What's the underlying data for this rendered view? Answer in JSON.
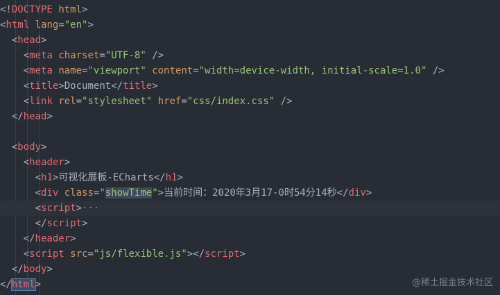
{
  "editor": {
    "theme": {
      "background": "#282c34",
      "tag": "#e06c75",
      "attr": "#d19a66",
      "string": "#98c379",
      "text": "#abb2bf"
    },
    "lines": [
      {
        "tokens": [
          {
            "t": "punct",
            "v": "<!"
          },
          {
            "t": "tag",
            "v": "DOCTYPE"
          },
          {
            "t": "punct",
            "v": " "
          },
          {
            "t": "attr",
            "v": "html"
          },
          {
            "t": "punct",
            "v": ">"
          }
        ]
      },
      {
        "tokens": [
          {
            "t": "punct",
            "v": "<"
          },
          {
            "t": "tag",
            "v": "html"
          },
          {
            "t": "punct",
            "v": " "
          },
          {
            "t": "attr",
            "v": "lang"
          },
          {
            "t": "punct",
            "v": "="
          },
          {
            "t": "str",
            "v": "\"en\""
          },
          {
            "t": "punct",
            "v": ">"
          }
        ]
      },
      {
        "tokens": [
          {
            "t": "punct",
            "v": "  <"
          },
          {
            "t": "tag",
            "v": "head"
          },
          {
            "t": "punct",
            "v": ">"
          }
        ]
      },
      {
        "tokens": [
          {
            "t": "punct",
            "v": "    <"
          },
          {
            "t": "tag",
            "v": "meta"
          },
          {
            "t": "punct",
            "v": " "
          },
          {
            "t": "attr",
            "v": "charset"
          },
          {
            "t": "punct",
            "v": "="
          },
          {
            "t": "str",
            "v": "\"UTF-8\""
          },
          {
            "t": "punct",
            "v": " />"
          }
        ]
      },
      {
        "tokens": [
          {
            "t": "punct",
            "v": "    <"
          },
          {
            "t": "tag",
            "v": "meta"
          },
          {
            "t": "punct",
            "v": " "
          },
          {
            "t": "attr",
            "v": "name"
          },
          {
            "t": "punct",
            "v": "="
          },
          {
            "t": "str",
            "v": "\"viewport\""
          },
          {
            "t": "punct",
            "v": " "
          },
          {
            "t": "attr",
            "v": "content"
          },
          {
            "t": "punct",
            "v": "="
          },
          {
            "t": "str",
            "v": "\"width=device-width, initial-scale=1.0\""
          },
          {
            "t": "punct",
            "v": " />"
          }
        ]
      },
      {
        "tokens": [
          {
            "t": "punct",
            "v": "    <"
          },
          {
            "t": "tag",
            "v": "title"
          },
          {
            "t": "punct",
            "v": ">"
          },
          {
            "t": "text",
            "v": "Document"
          },
          {
            "t": "punct",
            "v": "</"
          },
          {
            "t": "tag",
            "v": "title"
          },
          {
            "t": "punct",
            "v": ">"
          }
        ]
      },
      {
        "tokens": [
          {
            "t": "punct",
            "v": "    <"
          },
          {
            "t": "tag",
            "v": "link"
          },
          {
            "t": "punct",
            "v": " "
          },
          {
            "t": "attr",
            "v": "rel"
          },
          {
            "t": "punct",
            "v": "="
          },
          {
            "t": "str",
            "v": "\"stylesheet\""
          },
          {
            "t": "punct",
            "v": " "
          },
          {
            "t": "attr",
            "v": "href"
          },
          {
            "t": "punct",
            "v": "="
          },
          {
            "t": "str",
            "v": "\"css/index.css\""
          },
          {
            "t": "punct",
            "v": " />"
          }
        ]
      },
      {
        "tokens": [
          {
            "t": "punct",
            "v": "  </"
          },
          {
            "t": "tag",
            "v": "head"
          },
          {
            "t": "punct",
            "v": ">"
          }
        ]
      },
      {
        "tokens": []
      },
      {
        "tokens": [
          {
            "t": "punct",
            "v": "  <"
          },
          {
            "t": "tag",
            "v": "body"
          },
          {
            "t": "punct",
            "v": ">"
          }
        ]
      },
      {
        "tokens": [
          {
            "t": "punct",
            "v": "    <"
          },
          {
            "t": "tag",
            "v": "header"
          },
          {
            "t": "punct",
            "v": ">"
          }
        ]
      },
      {
        "tokens": [
          {
            "t": "punct",
            "v": "      <"
          },
          {
            "t": "tag",
            "v": "h1"
          },
          {
            "t": "punct",
            "v": ">"
          },
          {
            "t": "text",
            "v": "可视化展板-ECharts"
          },
          {
            "t": "punct",
            "v": "</"
          },
          {
            "t": "tag",
            "v": "h1"
          },
          {
            "t": "punct",
            "v": ">"
          }
        ]
      },
      {
        "tokens": [
          {
            "t": "punct",
            "v": "      <"
          },
          {
            "t": "tag",
            "v": "div"
          },
          {
            "t": "punct",
            "v": " "
          },
          {
            "t": "attr",
            "v": "class"
          },
          {
            "t": "punct",
            "v": "="
          },
          {
            "t": "str",
            "v": "\""
          },
          {
            "t": "str-hl",
            "v": "showTime"
          },
          {
            "t": "str",
            "v": "\""
          },
          {
            "t": "punct",
            "v": ">"
          },
          {
            "t": "text",
            "v": "当前时间：2020年3月17-0时54分14秒"
          },
          {
            "t": "punct",
            "v": "</"
          },
          {
            "t": "tag",
            "v": "div"
          },
          {
            "t": "punct",
            "v": ">"
          }
        ]
      },
      {
        "tokens": [
          {
            "t": "punct",
            "v": "      <"
          },
          {
            "t": "tag",
            "v": "script"
          },
          {
            "t": "punct",
            "v": ">"
          },
          {
            "t": "fold",
            "v": "···"
          }
        ]
      },
      {
        "tokens": [
          {
            "t": "punct",
            "v": "      </"
          },
          {
            "t": "tag",
            "v": "script"
          },
          {
            "t": "punct",
            "v": ">"
          }
        ]
      },
      {
        "tokens": [
          {
            "t": "punct",
            "v": "    </"
          },
          {
            "t": "tag",
            "v": "header"
          },
          {
            "t": "punct",
            "v": ">"
          }
        ]
      },
      {
        "tokens": [
          {
            "t": "punct",
            "v": "    <"
          },
          {
            "t": "tag",
            "v": "script"
          },
          {
            "t": "punct",
            "v": " "
          },
          {
            "t": "attr",
            "v": "src"
          },
          {
            "t": "punct",
            "v": "="
          },
          {
            "t": "str",
            "v": "\"js/flexible.js\""
          },
          {
            "t": "punct",
            "v": "></"
          },
          {
            "t": "tag",
            "v": "script"
          },
          {
            "t": "punct",
            "v": ">"
          }
        ]
      },
      {
        "tokens": [
          {
            "t": "punct",
            "v": "  </"
          },
          {
            "t": "tag",
            "v": "body"
          },
          {
            "t": "punct",
            "v": ">"
          }
        ]
      },
      {
        "tokens": [
          {
            "t": "punct",
            "v": "</"
          },
          {
            "t": "tag-match",
            "v": "html"
          },
          {
            "t": "punct",
            "v": ">"
          }
        ]
      }
    ],
    "current_line_index": 13
  },
  "watermark": "@稀土掘金技术社区"
}
